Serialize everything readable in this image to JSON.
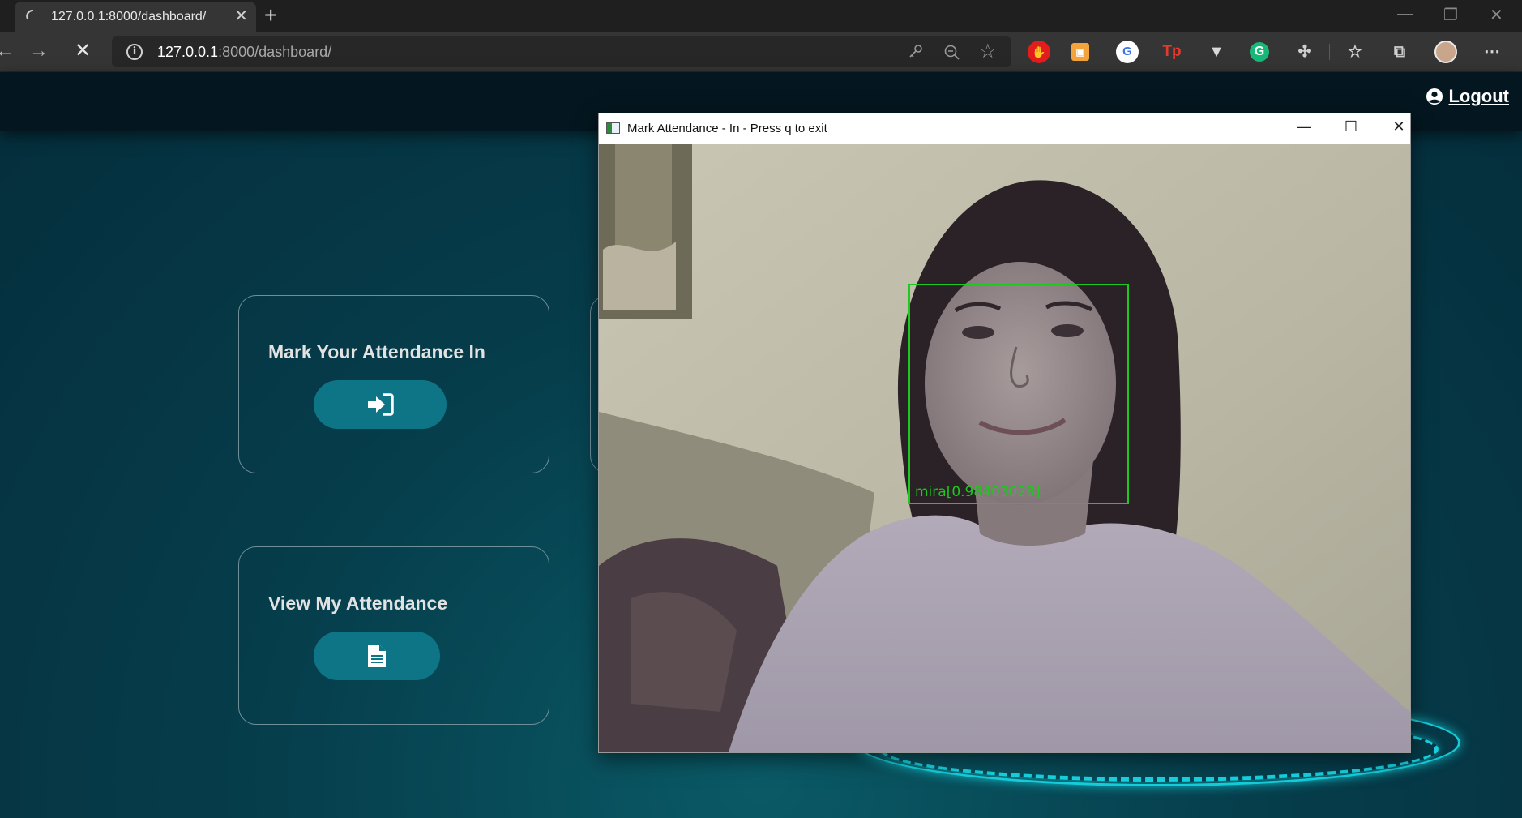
{
  "browser": {
    "tab_title": "127.0.0.1:8000/dashboard/",
    "url_host": "127.0.0.1",
    "url_rest": ":8000/dashboard/"
  },
  "header": {
    "logout_label": "Logout"
  },
  "cards": [
    {
      "title": "Mark Your Attendance In",
      "button_icon": "sign-in-icon"
    },
    {
      "title": "View My Attendance",
      "button_icon": "document-icon"
    }
  ],
  "camera_window": {
    "title": "Mark Attendance - In - Press q to exit",
    "detection_label": "mira[0.98403028]"
  },
  "colors": {
    "accent_button": "#0e7586",
    "page_bg": "#063e4c",
    "detection_box": "#1ec81e",
    "ring_glow": "#19e3f0"
  }
}
